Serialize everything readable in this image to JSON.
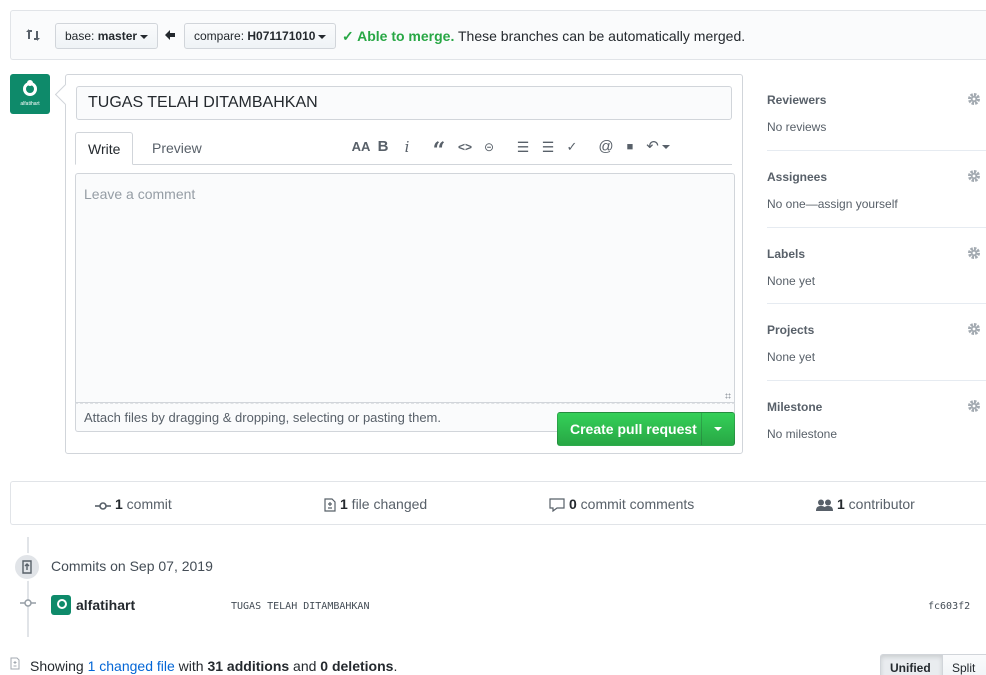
{
  "compare": {
    "base_prefix": "base: ",
    "base_branch": "master",
    "compare_prefix": "compare: ",
    "compare_branch": "H071171010",
    "merge_ok": "✓ Able to merge.",
    "merge_text": " These branches can be automatically merged."
  },
  "avatar": {
    "label": "alfatihart"
  },
  "form": {
    "title_value": "TUGAS TELAH DITAMBAHKAN",
    "tabs": [
      "Write",
      "Preview"
    ],
    "toolbar": {
      "header": "AA",
      "bold": "B",
      "italic": "i",
      "quote": "“",
      "code": "<>",
      "link": "⊝",
      "ul": "☰",
      "ol": "☰",
      "task": "✓",
      "mention": "@",
      "ref": "■",
      "reply": "↶"
    },
    "placeholder": "Leave a comment",
    "attach_text": "Attach files by dragging & dropping, selecting or pasting them.",
    "markdown_badge": "M↓",
    "submit_label": "Create pull request"
  },
  "sidebar": {
    "sections": [
      {
        "title": "Reviewers",
        "value": "No reviews"
      },
      {
        "title": "Assignees",
        "value": "No one—assign yourself"
      },
      {
        "title": "Labels",
        "value": "None yet"
      },
      {
        "title": "Projects",
        "value": "None yet"
      },
      {
        "title": "Milestone",
        "value": "No milestone"
      }
    ]
  },
  "stats": {
    "commits_count": "1",
    "commits_label": " commit",
    "files_count": "1",
    "files_label": " file changed",
    "comments_count": "0",
    "comments_label": " commit comments",
    "contributors_count": "1",
    "contributors_label": " contributor"
  },
  "commits": {
    "group_title": "Commits on Sep 07, 2019",
    "items": [
      {
        "author": "alfatihart",
        "message": "TUGAS TELAH DITAMBAHKAN",
        "sha": "fc603f2"
      }
    ]
  },
  "diff_summary": {
    "prefix": "Showing ",
    "changed_link": "1 changed file",
    "with": " with ",
    "additions": "31 additions",
    "and": " and ",
    "deletions": "0 deletions",
    "suffix": ".",
    "view_unified": "Unified",
    "view_split": "Split"
  },
  "colors": {
    "green": "#28a745",
    "link": "#0366d6",
    "border": "#d1d5da"
  }
}
